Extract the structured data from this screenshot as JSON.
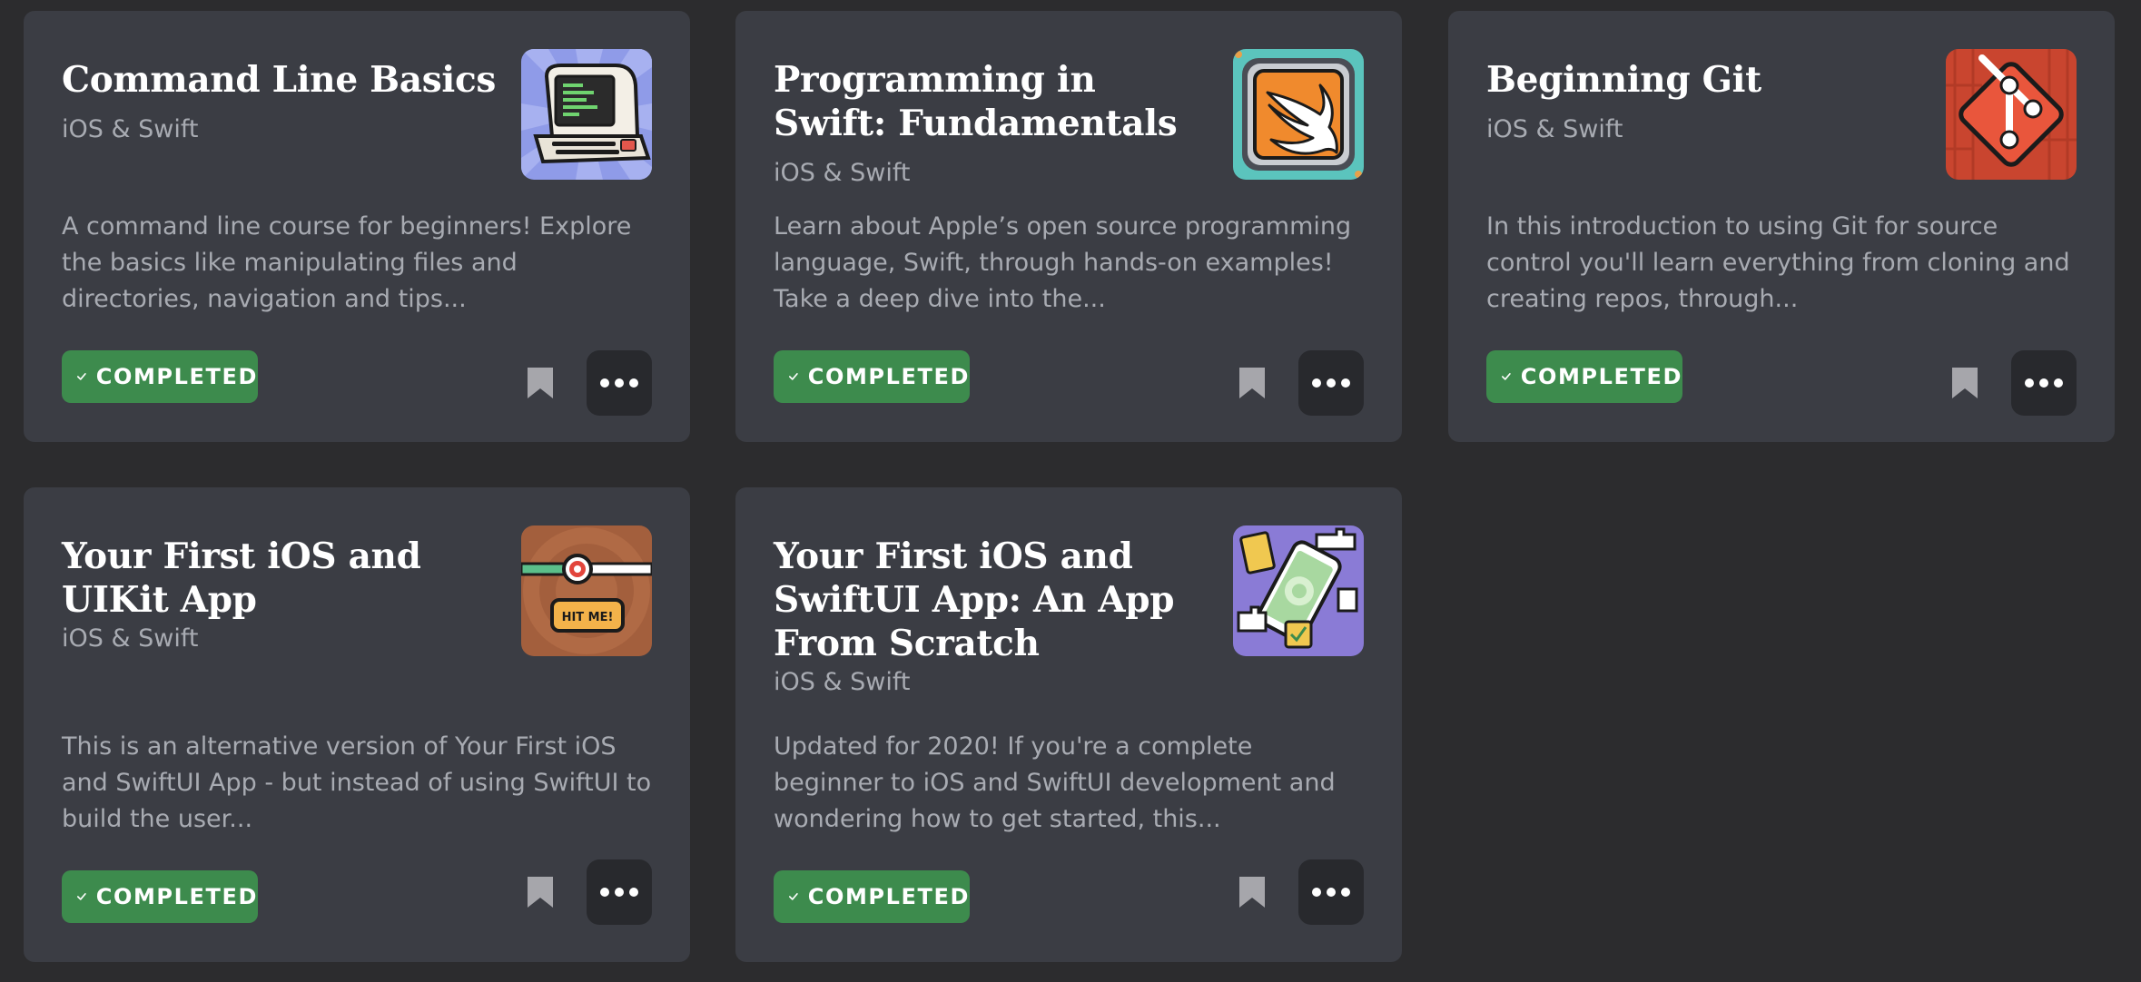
{
  "courses": [
    {
      "title": "Command Line Basics",
      "category": "iOS & Swift",
      "description": "A command line course for beginners! Explore the basics like manipulating files and directories, navigation and tips...",
      "status": "COMPLETED",
      "artwork": "retro-computer-terminal-icon"
    },
    {
      "title": "Programming in Swift: Fundamentals",
      "category": "iOS & Swift",
      "description": "Learn about Apple’s open source programming language, Swift, through hands-on examples! Take a deep dive into the...",
      "status": "COMPLETED",
      "artwork": "swift-bird-logo-icon"
    },
    {
      "title": "Beginning Git",
      "category": "iOS & Swift",
      "description": "In this introduction to using Git for source control you'll learn everything from cloning and creating repos, through...",
      "status": "COMPLETED",
      "artwork": "git-logo-icon"
    },
    {
      "title": "Your First iOS and UIKit App",
      "category": "iOS & Swift",
      "description": "This is an alternative version of Your First iOS and SwiftUI App - but instead of using SwiftUI to build the user...",
      "status": "COMPLETED",
      "artwork": "bullseye-hit-me-slider-icon",
      "artwork_text": "HIT ME!"
    },
    {
      "title": "Your First iOS and SwiftUI App: An App From Scratch",
      "category": "iOS & Swift",
      "description": "Updated for 2020! If you're a complete beginner to iOS and SwiftUI development and wondering how to get started, this...",
      "status": "COMPLETED",
      "artwork": "phone-puzzle-pieces-icon"
    }
  ],
  "icons": {
    "status": "checkmark-icon",
    "bookmark": "bookmark-icon",
    "more": "ellipsis-icon"
  },
  "colors": {
    "page_background": "#2c2c2e",
    "card_background": "#3b3d44",
    "completed_badge": "#3d8b4d",
    "more_button": "#28292d",
    "muted_text": "#a8abb2"
  }
}
